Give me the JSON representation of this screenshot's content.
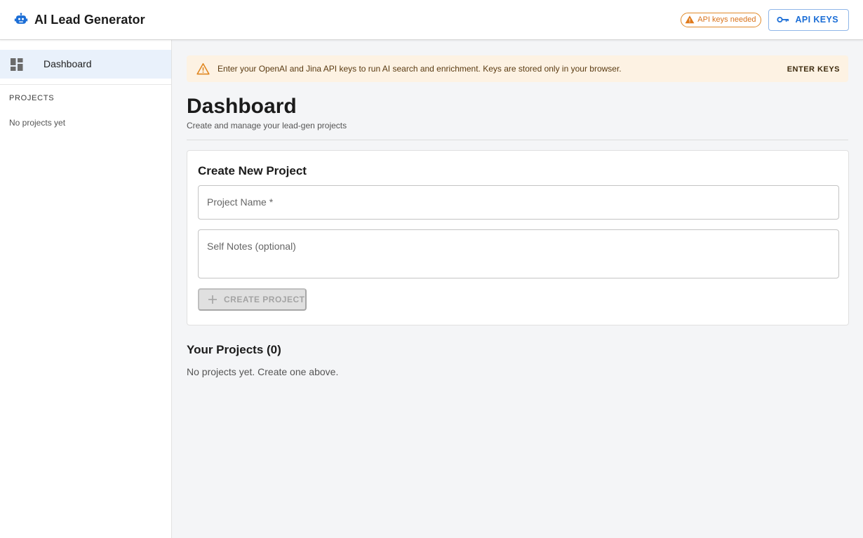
{
  "app": {
    "title": "AI Lead Generator",
    "brand_icon": "robot-icon",
    "brand_color": "#1a6dd6"
  },
  "header": {
    "status_chip": {
      "label": "API keys needed",
      "icon": "warning-icon",
      "color": "#d9731b"
    },
    "api_keys_button": {
      "label": "API KEYS",
      "icon": "key-icon"
    }
  },
  "sidebar": {
    "items": [
      {
        "label": "Dashboard",
        "icon": "dashboard-icon",
        "selected": true
      }
    ],
    "projects_heading": "PROJECTS",
    "projects_empty": "No projects yet"
  },
  "alert": {
    "icon": "warning-icon",
    "message": "Enter your OpenAI and Jina API keys to run AI search and enrichment. Keys are stored only in your browser.",
    "action_label": "ENTER KEYS"
  },
  "page": {
    "title": "Dashboard",
    "subtitle": "Create and manage your lead-gen projects"
  },
  "create_project": {
    "title": "Create New Project",
    "name_placeholder": "Project Name *",
    "name_value": "",
    "notes_placeholder": "Self Notes (optional)",
    "notes_value": "",
    "button_label": "CREATE PROJECT",
    "button_icon": "plus-icon",
    "button_disabled": true
  },
  "projects": {
    "title": "Your Projects (0)",
    "empty_message": "No projects yet. Create one above."
  }
}
